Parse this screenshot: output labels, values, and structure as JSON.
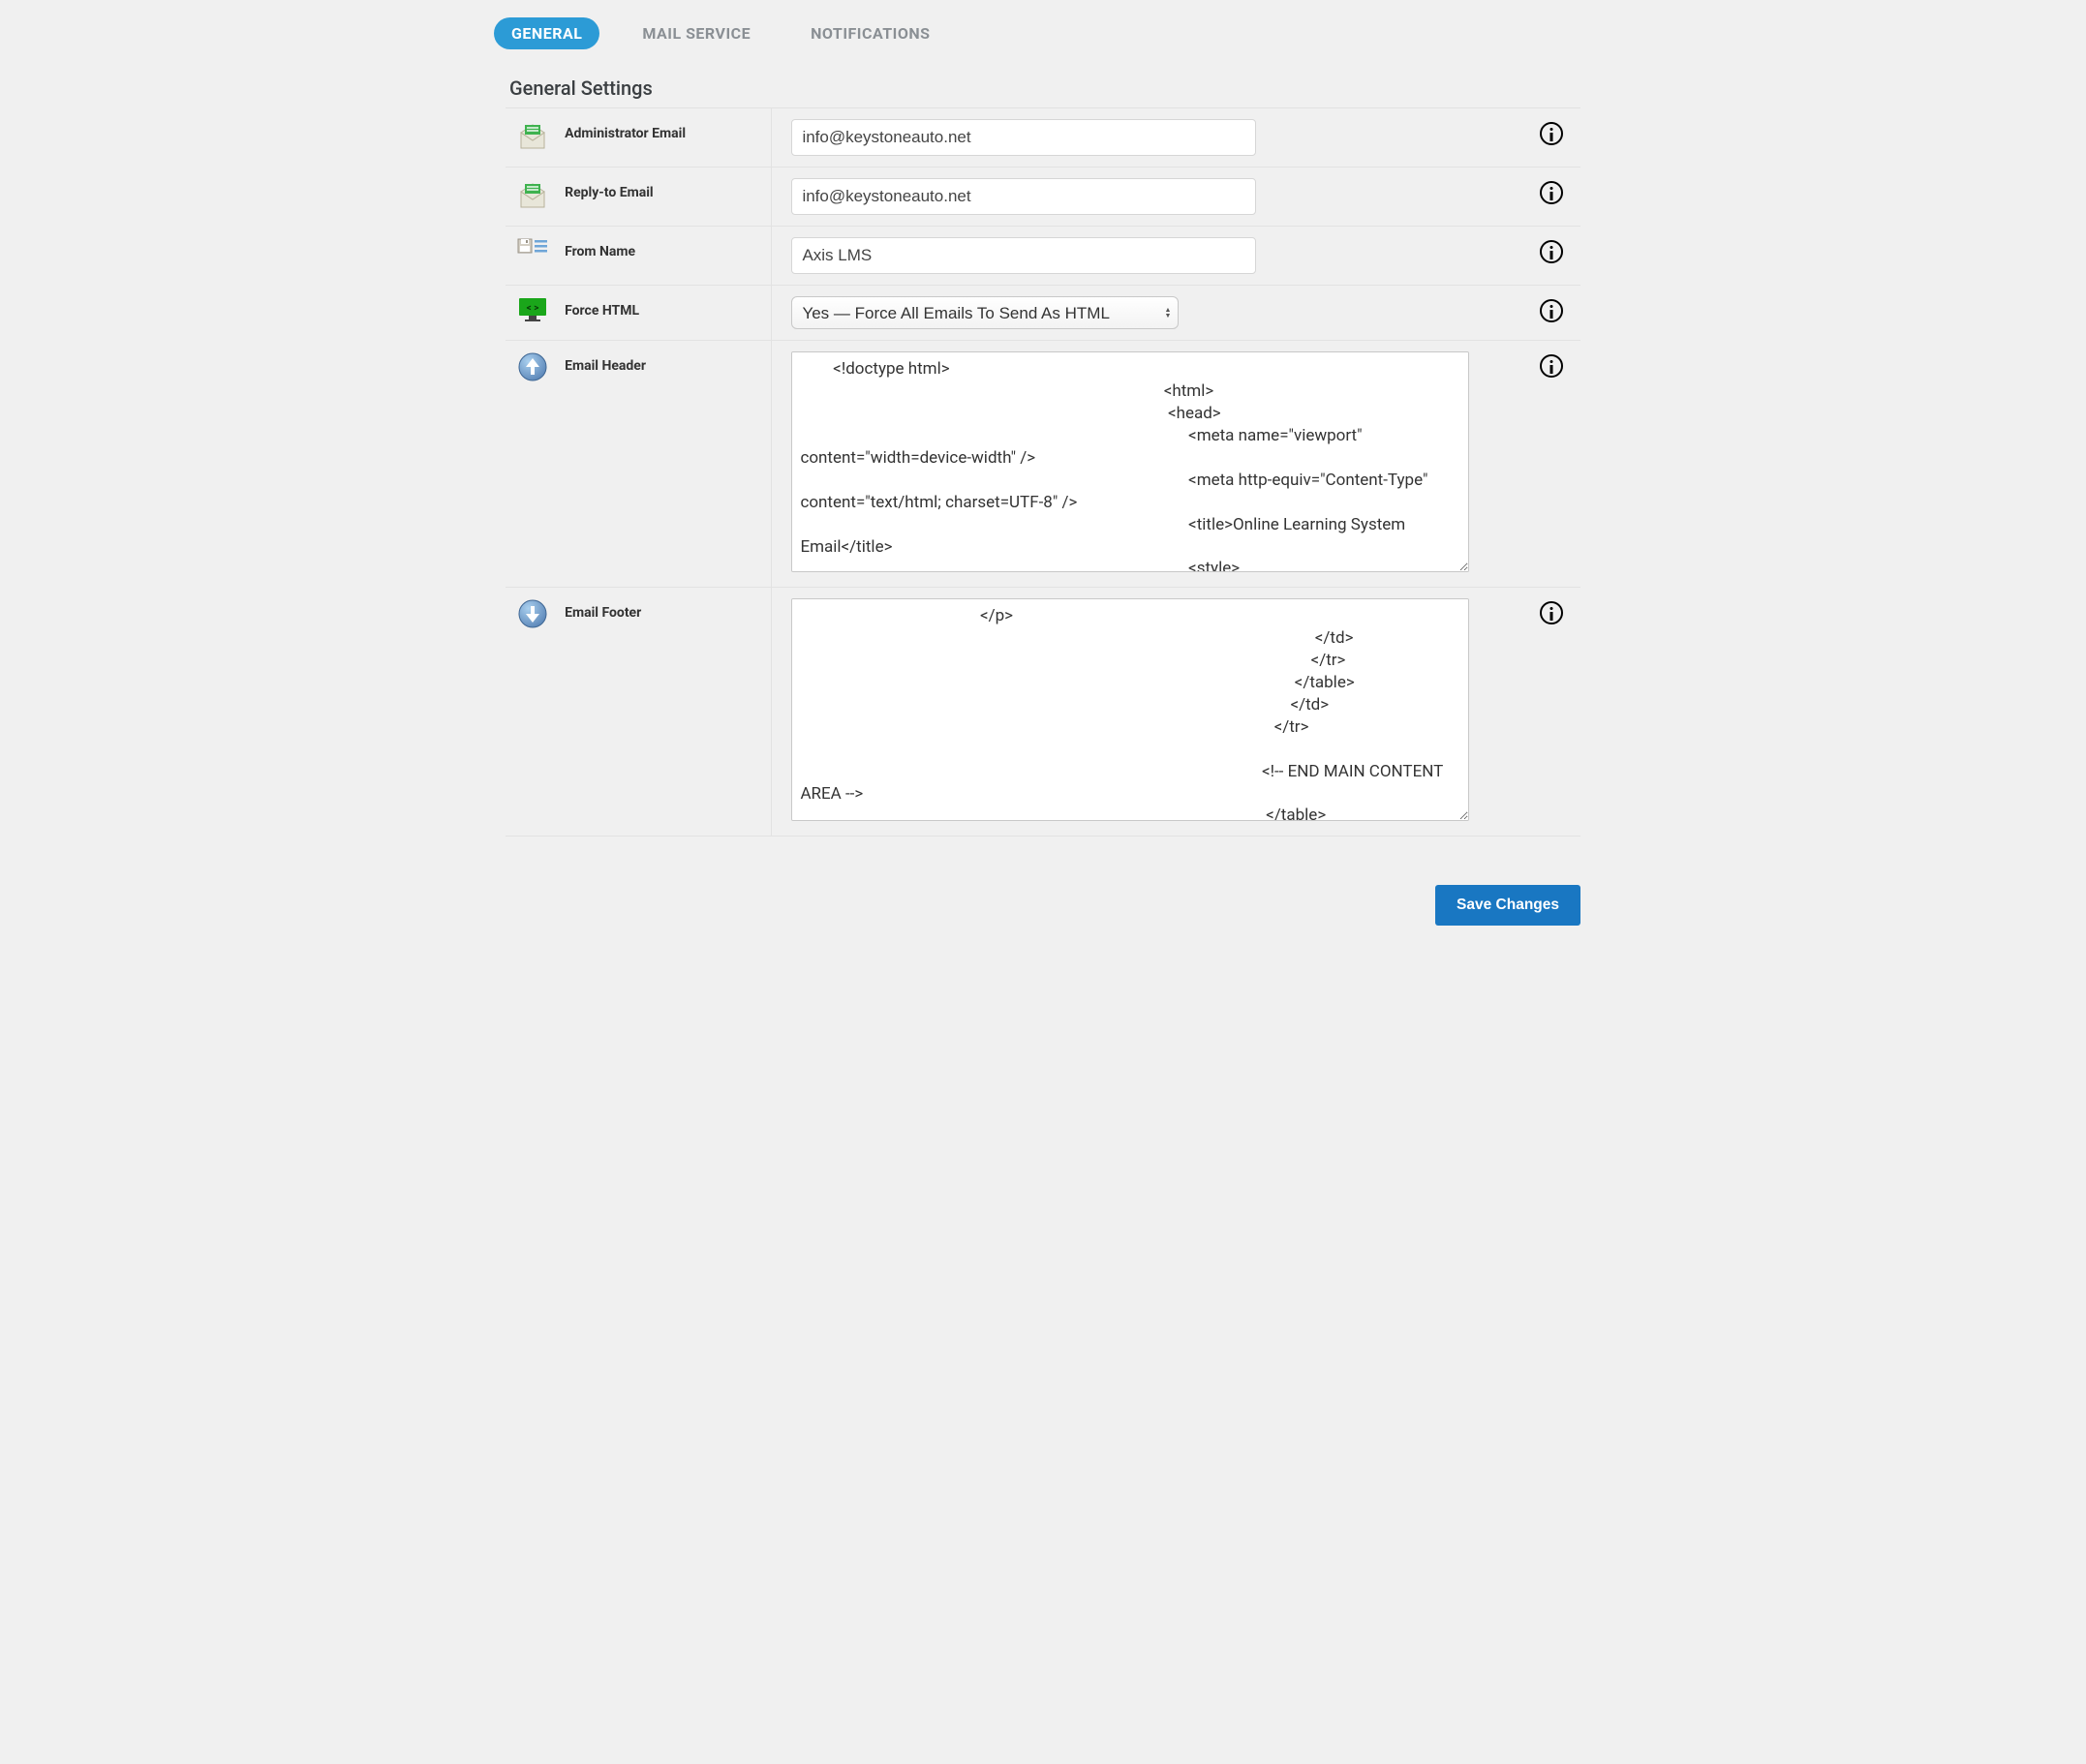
{
  "tabs": {
    "general": "GENERAL",
    "mail_service": "MAIL SERVICE",
    "notifications": "NOTIFICATIONS"
  },
  "section_title": "General Settings",
  "rows": {
    "admin_email": {
      "label": "Administrator Email",
      "value": "info@keystoneauto.net"
    },
    "reply_to": {
      "label": "Reply-to Email",
      "value": "info@keystoneauto.net"
    },
    "from_name": {
      "label": "From Name",
      "value": "Axis LMS"
    },
    "force_html": {
      "label": "Force HTML",
      "selected": "Yes — Force All Emails To Send As HTML"
    },
    "email_header": {
      "label": "Email Header",
      "value": "        <!doctype html>\n                                                                                         <html>\n                                                                                          <head>\n                                                                                               <meta name=\"viewport\" content=\"width=device-width\" />\n                                                                                               <meta http-equiv=\"Content-Type\" content=\"text/html; charset=UTF-8\" />\n                                                                                               <title>Online Learning System Email</title>\n                                                                                               <style>"
    },
    "email_footer": {
      "label": "Email Footer",
      "value": "                                            </p>\n                                                                                                                              </td>\n                                                                                                                             </tr>\n                                                                                                                         </table>\n                                                                                                                        </td>\n                                                                                                                    </tr>\n\n                                                                                                                 <!-- END MAIN CONTENT AREA -->\n                                                                                                                  </table>"
    }
  },
  "buttons": {
    "save": "Save Changes"
  }
}
